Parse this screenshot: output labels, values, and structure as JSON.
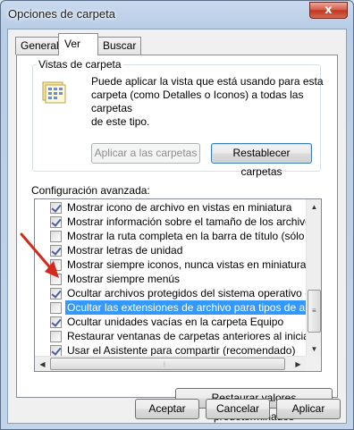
{
  "window": {
    "title": "Opciones de carpeta",
    "close_glyph": "x"
  },
  "tabs": [
    {
      "label": "General",
      "active": false
    },
    {
      "label": "Ver",
      "active": true
    },
    {
      "label": "Buscar",
      "active": false
    }
  ],
  "folder_views": {
    "legend": "Vistas de carpeta",
    "description_lines": [
      "Puede aplicar la vista que está usando para esta",
      "carpeta (como Detalles o Iconos) a todas las carpetas",
      "de este tipo."
    ],
    "apply_button": "Aplicar a las carpetas",
    "reset_button": "Restablecer carpetas",
    "icon": "folder-view-icon"
  },
  "advanced": {
    "label": "Configuración avanzada:",
    "items": [
      {
        "label": "Mostrar icono de archivo en vistas en miniatura",
        "checked": true,
        "selected": false
      },
      {
        "label": "Mostrar información sobre el tamaño de los archivos en su",
        "checked": true,
        "selected": false
      },
      {
        "label": "Mostrar la ruta completa en la barra de título (sólo el tema",
        "checked": false,
        "selected": false
      },
      {
        "label": "Mostrar letras de unidad",
        "checked": true,
        "selected": false
      },
      {
        "label": "Mostrar siempre iconos, nunca vistas en miniatura",
        "checked": false,
        "selected": false
      },
      {
        "label": "Mostrar siempre menús",
        "checked": false,
        "selected": false
      },
      {
        "label": "Ocultar archivos protegidos del sistema operativo (recome",
        "checked": true,
        "selected": false
      },
      {
        "label": "Ocultar las extensiones de archivo para tipos de archivo c",
        "checked": false,
        "selected": true
      },
      {
        "label": "Ocultar unidades vacías en la carpeta Equipo",
        "checked": true,
        "selected": false
      },
      {
        "label": "Restaurar ventanas de carpetas anteriores al iniciar sesió",
        "checked": false,
        "selected": false
      },
      {
        "label": "Usar el Asistente para compartir (recomendado)",
        "checked": true,
        "selected": false
      }
    ],
    "restore_defaults_button": "Restaurar valores predeterminados"
  },
  "footer": {
    "ok": "Aceptar",
    "cancel": "Cancelar",
    "apply": "Aplicar"
  },
  "colors": {
    "selection": "#3399ff",
    "annotation_arrow": "#d42a1e"
  }
}
